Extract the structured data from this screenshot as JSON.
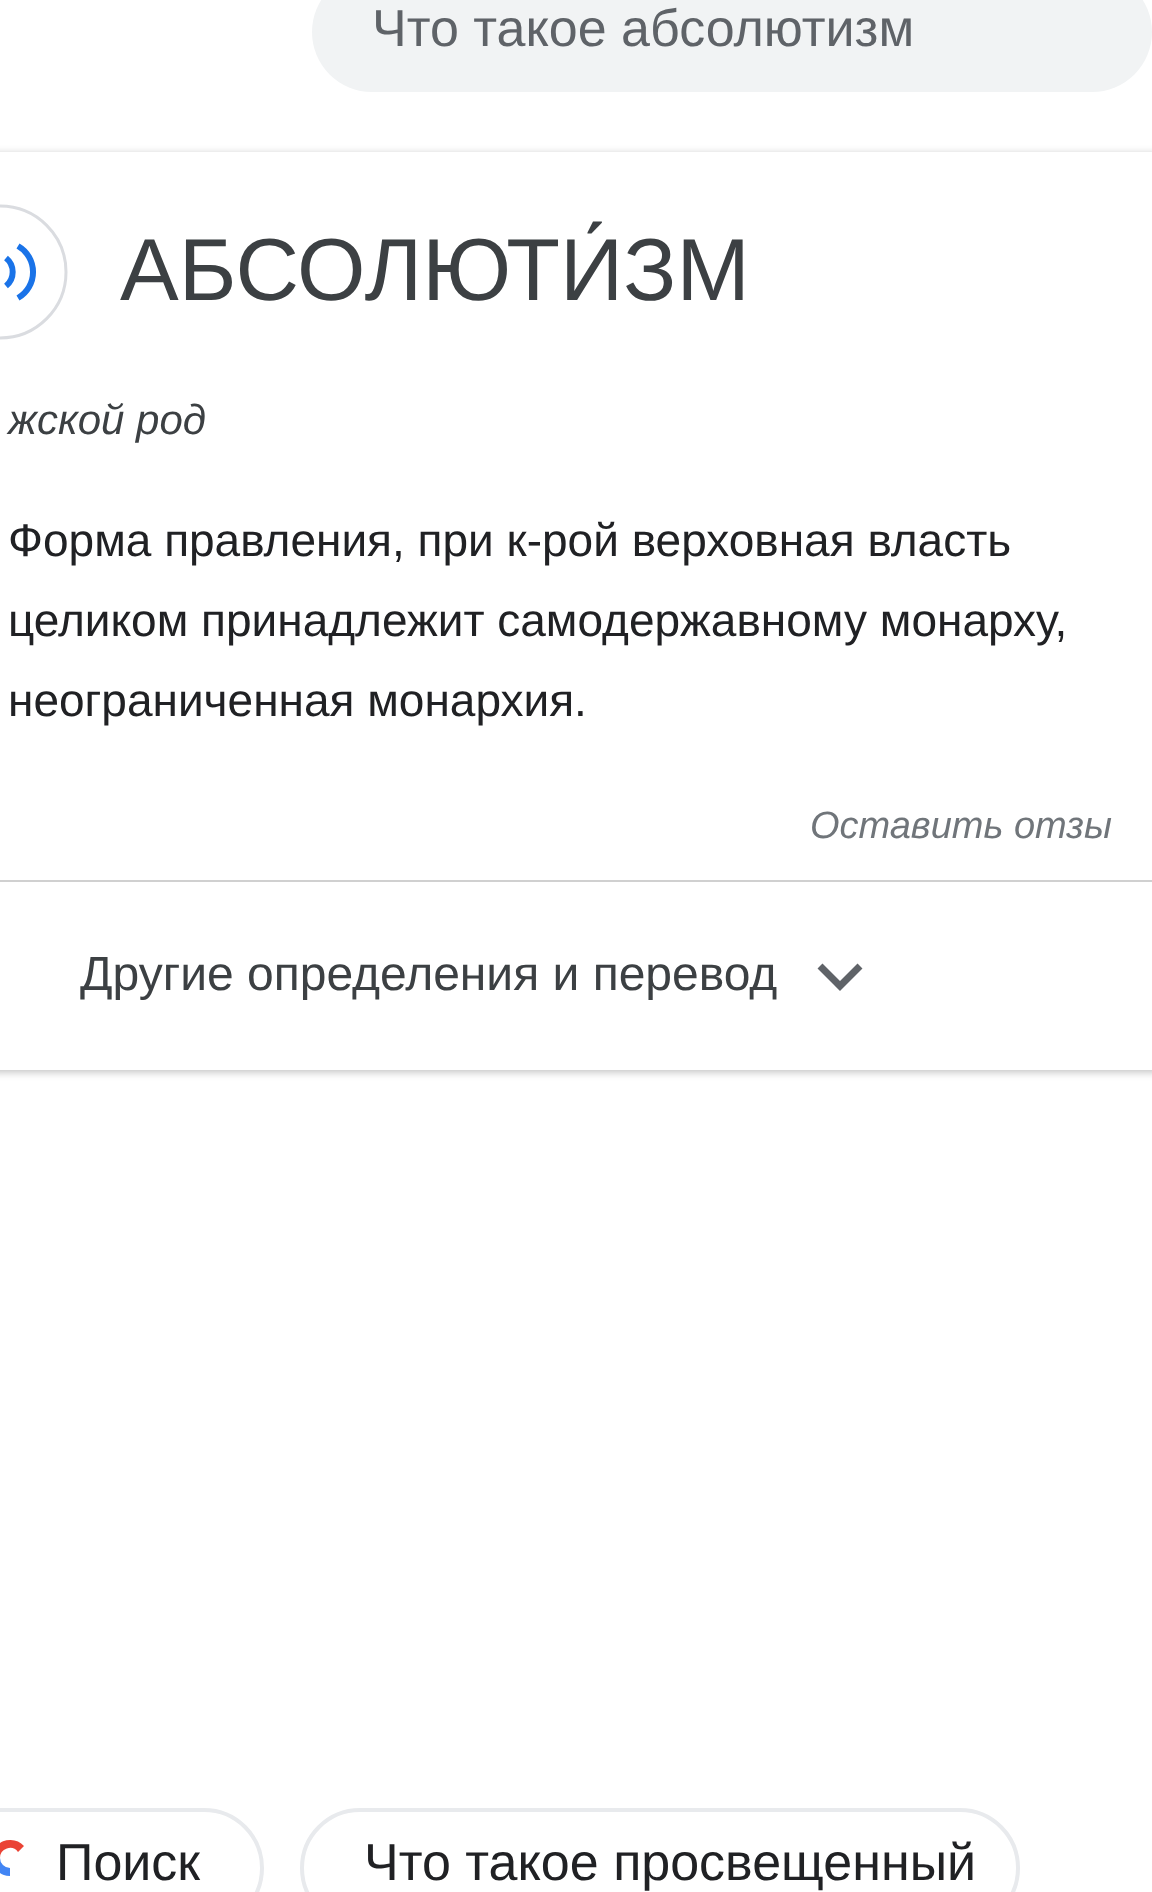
{
  "query_bubble": {
    "text": "Что такое абсолютизм"
  },
  "dictionary_card": {
    "headword": "АБСОЛЮТИ́ЗМ",
    "gender": "жской род",
    "definition": "Форма правления, при к-рой верховная власть целиком принадлежит самодержавному монарху, неограниченная монархия.",
    "feedback_link": "Оставить отзы",
    "more_row": {
      "label": "Другие определения и перевод",
      "expanded": false
    }
  },
  "suggestion_chips": [
    {
      "kind": "search",
      "label": "Поиск"
    },
    {
      "kind": "query",
      "label": "Что такое просвещенный"
    }
  ]
}
